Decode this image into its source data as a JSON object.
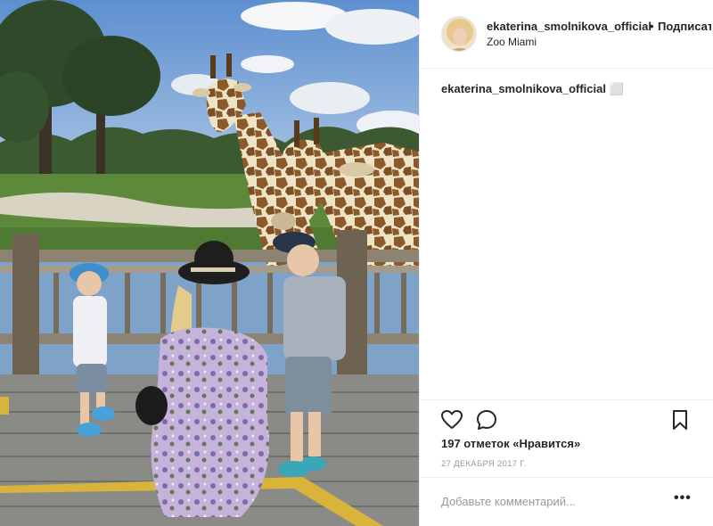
{
  "post": {
    "username": "ekaterina_smolnikova_official",
    "separator": "•",
    "follow_label": "Подписаться",
    "location": "Zoo Miami",
    "caption_user": "ekaterina_smolnikova_official",
    "caption_text": "⬜",
    "likes": "197 отметок «Нравится»",
    "date": "27 ДЕКАБРЯ 2017 Г.",
    "comment_placeholder": "Добавьте комментарий...",
    "more_label": "•••"
  },
  "icons": {
    "like": "heart-outline-icon",
    "comment": "speech-bubble-icon",
    "save": "bookmark-icon"
  },
  "colors": {
    "text": "#262626",
    "muted": "#999999",
    "divider": "#efefef"
  }
}
